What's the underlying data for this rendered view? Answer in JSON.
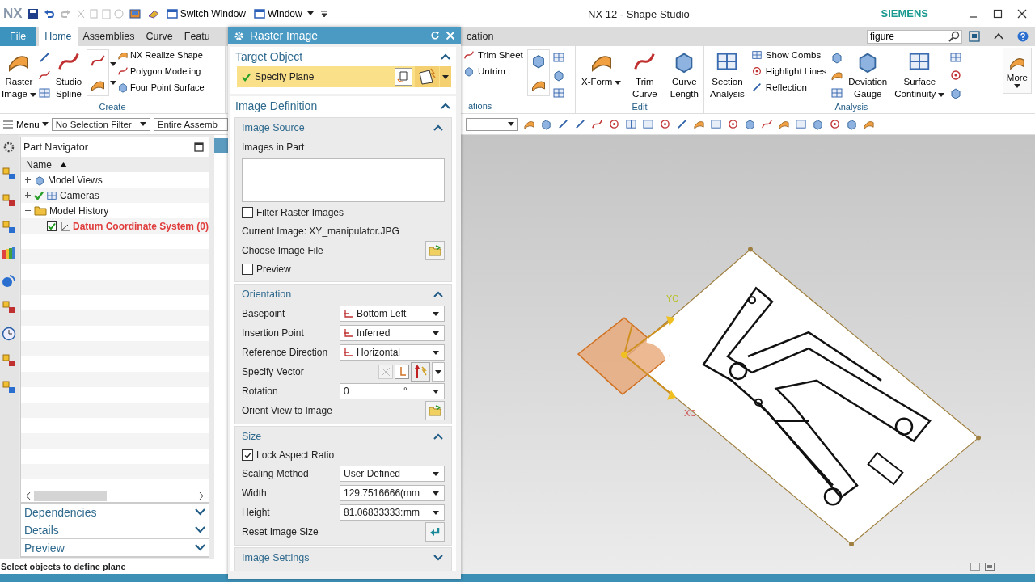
{
  "title_bar": {
    "logo": "NX",
    "quick_access": [
      {
        "label": "Switch Window",
        "dropdown": false
      },
      {
        "label": "Window",
        "dropdown": true
      }
    ],
    "title": "NX 12 - Shape Studio",
    "brand": "SIEMENS"
  },
  "tabs": [
    {
      "label": "File",
      "kind": "file",
      "selected": false
    },
    {
      "label": "Home",
      "kind": "tab",
      "selected": true
    },
    {
      "label": "Assemblies",
      "kind": "tab",
      "selected": false
    },
    {
      "label": "Curve",
      "kind": "tab",
      "selected": false
    },
    {
      "label": "Featu",
      "kind": "tab",
      "selected": false
    },
    {
      "label": "cation",
      "kind": "tab",
      "selected": false
    }
  ],
  "search": {
    "value": "figure"
  },
  "ribbon": [
    {
      "label": "Create",
      "large": [
        {
          "label": "Raster Image",
          "dropdown": true
        },
        {
          "label": "Studio Spline",
          "dropdown": false
        }
      ],
      "small": [
        "NX Realize Shape",
        "Polygon Modeling",
        "Four Point Surface"
      ]
    },
    {
      "label": "ations",
      "small": [
        "Trim Sheet",
        "Untrim"
      ]
    },
    {
      "label": "Edit",
      "large": [
        {
          "label": "X-Form",
          "dropdown": true
        },
        {
          "label": "Trim Curve",
          "dropdown": false
        },
        {
          "label": "Curve Length",
          "dropdown": false
        }
      ]
    },
    {
      "label": "Analysis",
      "large": [
        {
          "label": "Section Analysis",
          "dropdown": false
        }
      ],
      "small": [
        "Show Combs",
        "Highlight Lines",
        "Reflection"
      ],
      "large_after": [
        {
          "label": "Deviation Gauge",
          "dropdown": false
        },
        {
          "label": "Surface Continuity",
          "dropdown": true
        }
      ]
    },
    {
      "label": "More"
    }
  ],
  "selection_bar": {
    "menu": "Menu",
    "filter": "No Selection Filter",
    "scope": "Entire Assemb"
  },
  "part_navigator": {
    "title": "Part Navigator",
    "column": "Name",
    "tree": [
      {
        "label": "Model Views",
        "expanded": false,
        "checked": false,
        "error": false
      },
      {
        "label": "Cameras",
        "expanded": false,
        "checked": true,
        "error": false
      },
      {
        "label": "Model History",
        "expanded": true,
        "checked": false,
        "error": false,
        "children": [
          {
            "label": "Datum Coordinate System (0)",
            "checked": true,
            "error": true
          }
        ]
      }
    ],
    "panels": [
      {
        "label": "Dependencies",
        "expanded": false
      },
      {
        "label": "Details",
        "expanded": false
      },
      {
        "label": "Preview",
        "expanded": false
      }
    ]
  },
  "status_bar": "Select objects to define plane",
  "graphics": {
    "axis_labels": [
      "YC",
      "XC"
    ]
  },
  "dialog": {
    "title": "Raster Image",
    "target": {
      "label": "Target Object",
      "expanded": true,
      "selector": {
        "label": "Specify Plane",
        "done": true
      }
    },
    "definition": {
      "label": "Image Definition",
      "expanded": true,
      "groups": [
        {
          "label": "Image Source",
          "expanded": true,
          "rows": [
            {
              "kind": "label",
              "label": "Images in Part"
            },
            {
              "kind": "list"
            },
            {
              "kind": "checkbox",
              "label": "Filter Raster Images",
              "checked": false
            },
            {
              "kind": "label",
              "label": "Current Image: XY_manipulator.JPG"
            },
            {
              "kind": "button",
              "label": "Choose Image File"
            },
            {
              "kind": "checkbox",
              "label": "Preview",
              "checked": false
            }
          ]
        },
        {
          "label": "Orientation",
          "expanded": true,
          "rows": [
            {
              "kind": "dropdown",
              "label": "Basepoint",
              "value": "Bottom Left",
              "icon": true
            },
            {
              "kind": "dropdown",
              "label": "Insertion Point",
              "value": "Inferred",
              "icon": true
            },
            {
              "kind": "dropdown",
              "label": "Reference Direction",
              "value": "Horizontal",
              "icon": true
            },
            {
              "kind": "vector",
              "label": "Specify Vector"
            },
            {
              "kind": "number",
              "label": "Rotation",
              "value": "0",
              "unit": "°"
            },
            {
              "kind": "button",
              "label": "Orient View to Image"
            }
          ]
        },
        {
          "label": "Size",
          "expanded": true,
          "rows": [
            {
              "kind": "checkbox",
              "label": "Lock Aspect Ratio",
              "checked": true
            },
            {
              "kind": "dropdown",
              "label": "Scaling Method",
              "value": "User Defined",
              "icon": false
            },
            {
              "kind": "number",
              "label": "Width",
              "value": "129.7516666(",
              "unit": "mm"
            },
            {
              "kind": "number",
              "label": "Height",
              "value": "81.06833333:",
              "unit": "mm"
            },
            {
              "kind": "button",
              "label": "Reset Image Size"
            }
          ]
        },
        {
          "label": "Image Settings",
          "expanded": false
        }
      ]
    }
  }
}
